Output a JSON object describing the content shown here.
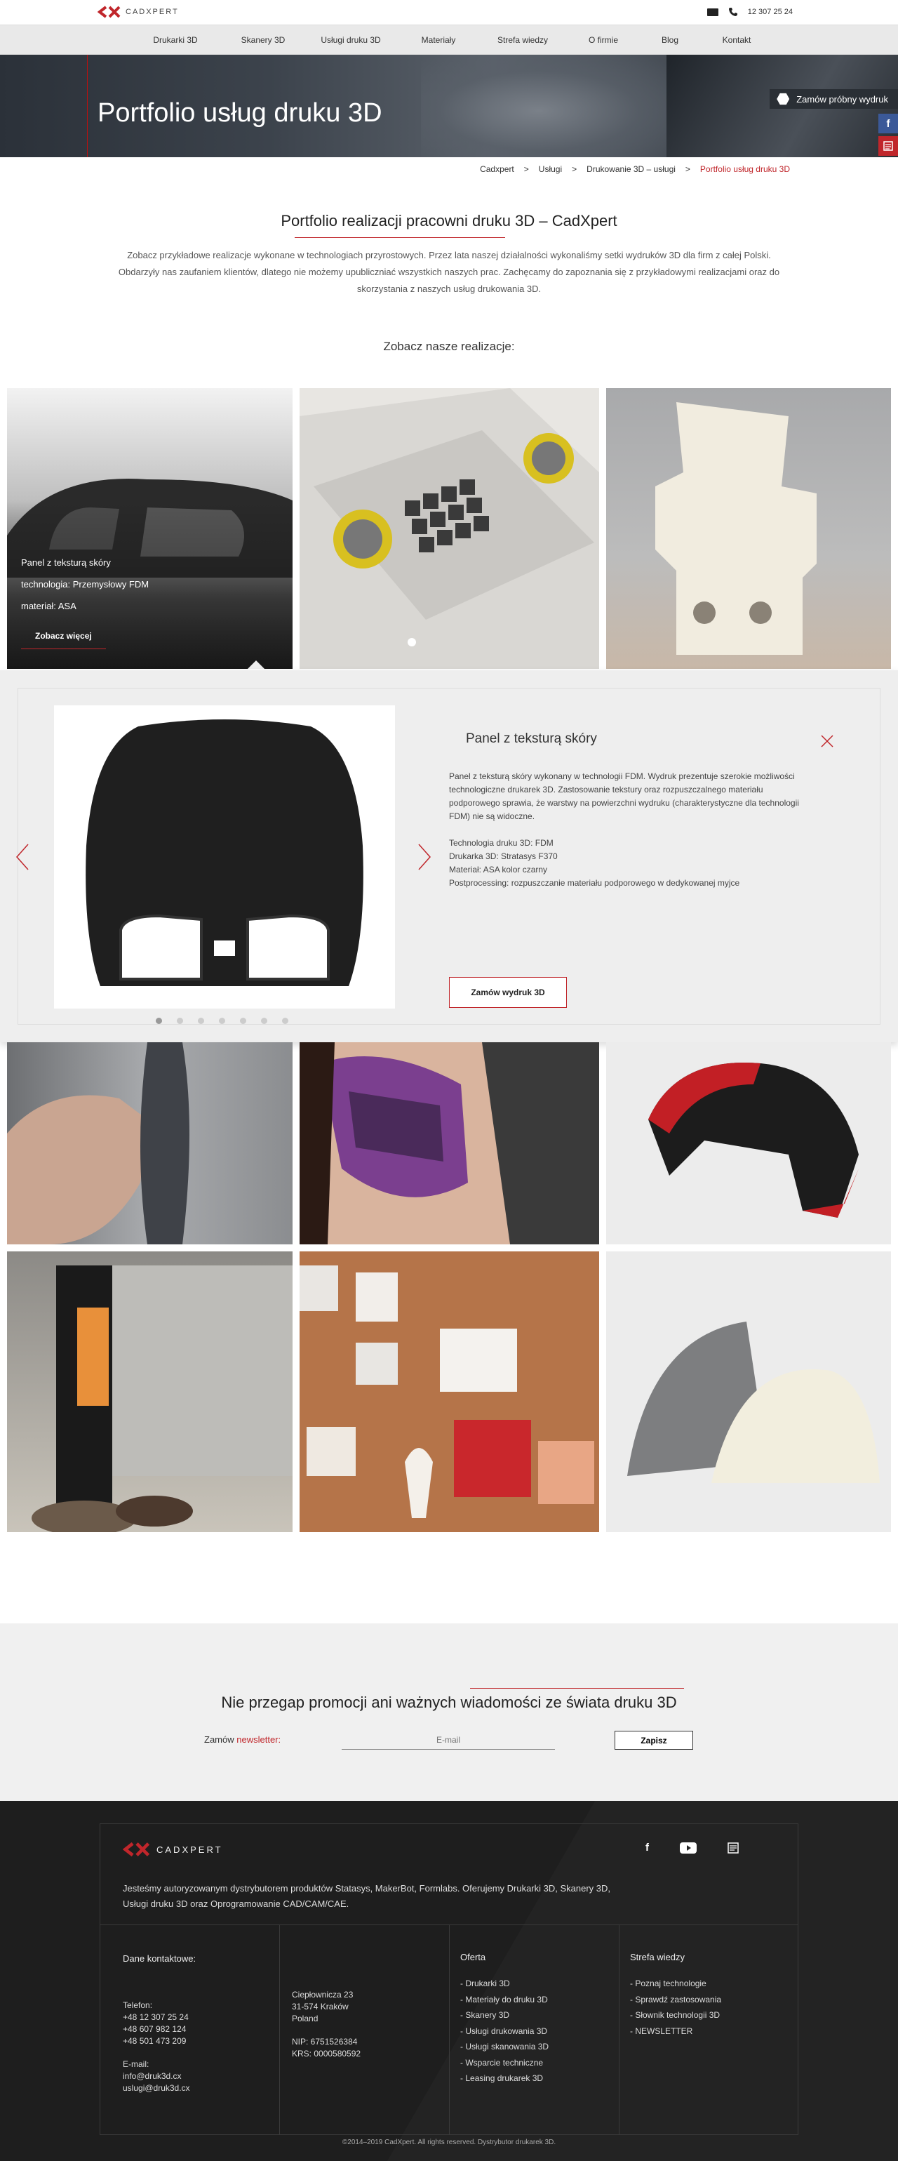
{
  "brand": {
    "logo_text": "CADXPERT",
    "accent": "#c0262b"
  },
  "topbar": {
    "phone": "12 307 25 24",
    "icons": [
      "envelope-icon",
      "phone-icon"
    ]
  },
  "nav": {
    "items": [
      "Drukarki 3D",
      "Skanery 3D",
      "Usługi druku 3D",
      "Materiały",
      "Strefa wiedzy",
      "O firmie",
      "Blog",
      "Kontakt"
    ]
  },
  "hero": {
    "title": "Portfolio usług druku 3D",
    "order_sample": "Zamów próbny wydruk"
  },
  "breadcrumb": {
    "items": [
      "Cadxpert",
      "Usługi",
      "Drukowanie 3D – usługi",
      "Portfolio usług druku 3D"
    ],
    "separator": ">"
  },
  "intro": {
    "title": "Portfolio realizacji pracowni druku 3D – CadXpert",
    "text": "Zobacz przykładowe realizacje wykonane w technologiach przyrostowych. Przez lata naszej działalności wykonaliśmy setki wydruków 3D dla firm z całej Polski. Obdarzyły nas zaufaniem klientów, dlatego nie możemy upubliczniać wszystkich naszych prac. Zachęcamy do zapoznania się z przykładowymi realizacjami oraz do skorzystania z naszych usług drukowania 3D.",
    "see_title": "Zobacz nasze realizacje:"
  },
  "gallery": {
    "active_caption": {
      "line1": "Panel z teksturą skóry",
      "line2": "technologia: Przemysłowy FDM",
      "line3": "materiał: ASA",
      "button": "Zobacz więcej"
    }
  },
  "detail": {
    "title": "Panel z teksturą skóry",
    "description": "Panel z teksturą skóry wykonany w technologii FDM. Wydruk prezentuje szerokie możliwości technologiczne drukarek 3D. Zastosowanie tekstury oraz rozpuszczalnego materiału podporowego sprawia, że warstwy na powierzchni wydruku (charakterystyczne dla technologii FDM) nie są widoczne.",
    "specs": [
      "Technologia druku 3D: FDM",
      "Drukarka 3D: Stratasys F370",
      "Materiał: ASA kolor czarny",
      "Postprocessing: rozpuszczanie materiału podporowego w dedykowanej myjce"
    ],
    "button": "Zamów wydruk 3D",
    "slides_total": 7,
    "slide_active": 1
  },
  "newsletter": {
    "title": "Nie przegap promocji ani ważnych wiadomości ze świata druku 3D",
    "label_prefix": "Zamów",
    "label_accent": "newsletter:",
    "placeholder": "E-mail",
    "button": "Zapisz"
  },
  "footer": {
    "about": "Jesteśmy autoryzowanym dystrybutorem produktów Statasys, MakerBot, Formlabs. Oferujemy Drukarki 3D, Skanery 3D, Usługi druku 3D oraz Oprogramowanie CAD/CAM/CAE.",
    "contact_title": "Dane kontaktowe:",
    "phone_label": "Telefon:",
    "phones": [
      "+48 12 307 25 24",
      "+48 607 982 124",
      "+48 501 473 209"
    ],
    "email_label": "E-mail:",
    "emails": [
      "info@druk3d.cx",
      "uslugi@druk3d.cx"
    ],
    "address": [
      "Ciepłownicza 23",
      "31-574 Kraków",
      "Poland"
    ],
    "nip": "NIP: 6751526384",
    "krs": "KRS: 0000580592",
    "offer_title": "Oferta",
    "offer": [
      "Drukarki 3D",
      "Materiały do druku 3D",
      "Skanery 3D",
      "Usługi drukowania 3D",
      "Usługi skanowania 3D",
      "Wsparcie techniczne",
      "Leasing drukarek 3D"
    ],
    "knowledge_title": "Strefa wiedzy",
    "knowledge": [
      "Poznaj technologie",
      "Sprawdź zastosowania",
      "Słownik technologii 3D",
      "NEWSLETTER"
    ],
    "copyright": "©2014–2019 CadXpert. All rights reserved. Dystrybutor drukarek 3D."
  }
}
